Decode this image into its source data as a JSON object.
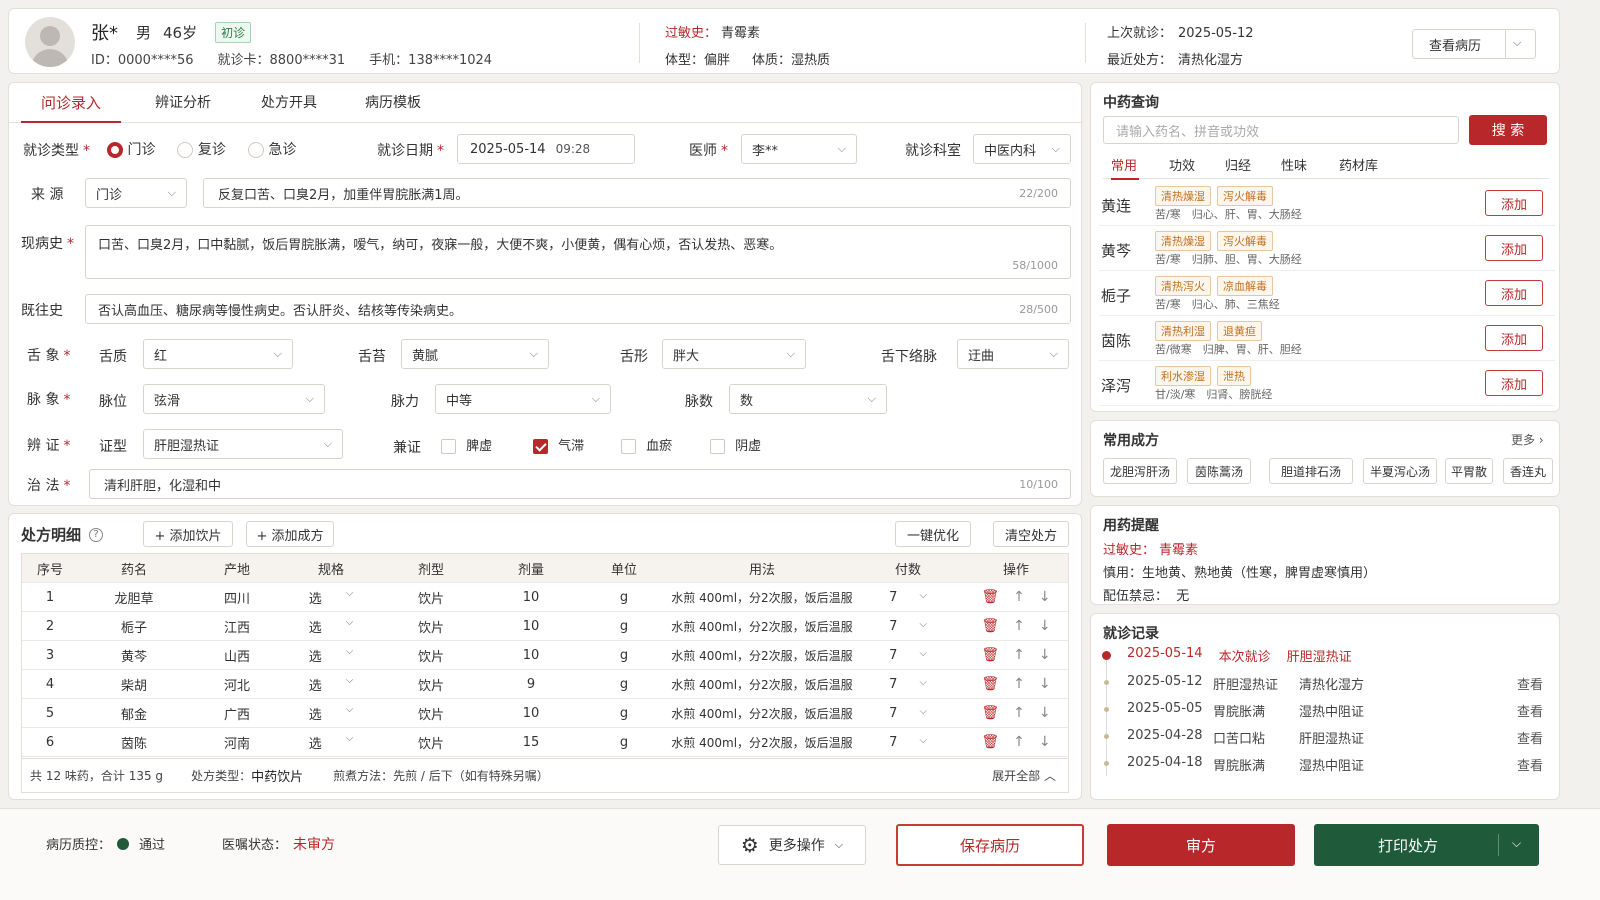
{
  "patient": {
    "name": "张*",
    "gender": "男",
    "age": "46岁",
    "visit_badge": "初诊",
    "id_label": "ID：",
    "id": "0000****56",
    "card_label": "就诊卡：",
    "card": "8800****31",
    "phone_label": "手机：",
    "phone": "138****1024",
    "allergy_label": "过敏史：",
    "allergy": "青霉素",
    "body_type_label": "体型：",
    "body_type": "偏胖",
    "constitution_label": "体质：",
    "constitution": "湿热质",
    "last_visit_label": "上次就诊：",
    "last_visit": "2025-05-12",
    "last_rx_label": "最近处方：",
    "last_rx": "清热化湿方",
    "view_record": "查看病历"
  },
  "tabs": [
    "问诊录入",
    "辨证分析",
    "处方开具",
    "病历模板"
  ],
  "form": {
    "visit_type_label": "就诊类型",
    "visit_types": [
      "门诊",
      "复诊",
      "急诊"
    ],
    "visit_date_label": "就诊日期",
    "visit_date": "2025-05-14",
    "visit_time": "09:28",
    "doctor_label": "医师",
    "doctor": "李**",
    "dept_label": "就诊科室",
    "dept": "中医内科",
    "source_label": "来 源",
    "source": "门诊",
    "chief_complaint": "反复口苦、口臭2月，加重伴胃脘胀满1周。",
    "chief_count": "22/200",
    "present_label": "现病史",
    "present": "口苦、口臭2月，口中黏腻，饭后胃脘胀满，嗳气，纳可，夜寐一般，大便不爽，小便黄，偶有心烦，否认发热、恶寒。",
    "present_count": "58/1000",
    "past_label": "既往史",
    "past": "否认高血压、糖尿病等慢性病史。否认肝炎、结核等传染病史。",
    "past_count": "28/500",
    "tongue_label": "舌 象",
    "tongue_quality_label": "舌质",
    "tongue_quality": "红",
    "tongue_coat_label": "舌苔",
    "tongue_coat": "黄腻",
    "tongue_shape_label": "舌形",
    "tongue_shape": "胖大",
    "sublingual_label": "舌下络脉",
    "sublingual": "迂曲",
    "pulse_label": "脉 象",
    "pulse_pos_label": "脉位",
    "pulse_pos": "弦滑",
    "pulse_force_label": "脉力",
    "pulse_force": "中等",
    "pulse_rate_label": "脉数",
    "pulse_rate": "数",
    "syndrome_label": "辨 证",
    "syndrome_type_label": "证型",
    "syndrome_type": "肝胆湿热证",
    "concurrent_label": "兼证",
    "concurrent": [
      "脾虚",
      "气滞",
      "血瘀",
      "阴虚"
    ],
    "treatment_label": "治 法",
    "treatment": "清利肝胆，化湿和中",
    "treatment_count": "10/100"
  },
  "rx": {
    "title": "处方明细",
    "add_piece": "+ 添加饮片",
    "add_formula": "+ 添加成方",
    "optimize": "一键优化",
    "clear": "清空处方",
    "headers": [
      "序号",
      "药名",
      "产地",
      "规格",
      "剂型",
      "剂量",
      "单位",
      "用法",
      "付数",
      "操作"
    ],
    "rows": [
      {
        "no": "1",
        "name": "龙胆草",
        "origin": "四川",
        "spec": "选",
        "form": "饮片",
        "dose": "10",
        "unit": "g",
        "usage": "水煎 400ml，分2次服，饭后温服",
        "count": "7"
      },
      {
        "no": "2",
        "name": "栀子",
        "origin": "江西",
        "spec": "选",
        "form": "饮片",
        "dose": "10",
        "unit": "g",
        "usage": "水煎 400ml，分2次服，饭后温服",
        "count": "7"
      },
      {
        "no": "3",
        "name": "黄芩",
        "origin": "山西",
        "spec": "选",
        "form": "饮片",
        "dose": "10",
        "unit": "g",
        "usage": "水煎 400ml，分2次服，饭后温服",
        "count": "7"
      },
      {
        "no": "4",
        "name": "柴胡",
        "origin": "河北",
        "spec": "选",
        "form": "饮片",
        "dose": "9",
        "unit": "g",
        "usage": "水煎 400ml，分2次服，饭后温服",
        "count": "7"
      },
      {
        "no": "5",
        "name": "郁金",
        "origin": "广西",
        "spec": "选",
        "form": "饮片",
        "dose": "10",
        "unit": "g",
        "usage": "水煎 400ml，分2次服，饭后温服",
        "count": "7"
      },
      {
        "no": "6",
        "name": "茵陈",
        "origin": "河南",
        "spec": "选",
        "form": "饮片",
        "dose": "15",
        "unit": "g",
        "usage": "水煎 400ml，分2次服，饭后温服",
        "count": "7"
      }
    ],
    "summary": "共 12 味药，合计 135 g",
    "type_label": "处方类型：",
    "type": "中药饮片",
    "decoct": "煎煮方法：先煎 / 后下（如有特殊另嘱）",
    "expand": "展开全部"
  },
  "herb_search": {
    "title": "中药查询",
    "placeholder": "请输入药名、拼音或功效",
    "search": "搜 索",
    "tabs": [
      "常用",
      "功效",
      "归经",
      "性味",
      "药材库"
    ],
    "add": "添加",
    "items": [
      {
        "name": "黄连",
        "tags": [
          "清热燥湿",
          "泻火解毒"
        ],
        "desc": "苦/寒　归心、肝、胃、大肠经"
      },
      {
        "name": "黄芩",
        "tags": [
          "清热燥湿",
          "泻火解毒"
        ],
        "desc": "苦/寒　归肺、胆、胃、大肠经"
      },
      {
        "name": "栀子",
        "tags": [
          "清热泻火",
          "凉血解毒"
        ],
        "desc": "苦/寒　归心、肺、三焦经"
      },
      {
        "name": "茵陈",
        "tags": [
          "清热利湿",
          "退黄疸"
        ],
        "desc": "苦/微寒　归脾、胃、肝、胆经"
      },
      {
        "name": "泽泻",
        "tags": [
          "利水渗湿",
          "泄热"
        ],
        "desc": "甘/淡/寒　归肾、膀胱经"
      }
    ]
  },
  "formulas": {
    "title": "常用成方",
    "more": "更多",
    "items": [
      "龙胆泻肝汤",
      "茵陈蒿汤",
      "胆道排石汤",
      "半夏泻心汤",
      "平胃散",
      "香连丸"
    ]
  },
  "reminder": {
    "title": "用药提醒",
    "allergy_label": "过敏史：",
    "allergy": "青霉素",
    "caution": "慎用：生地黄、熟地黄（性寒，脾胃虚寒慎用）",
    "contra": "配伍禁忌：  无"
  },
  "history": {
    "title": "就诊记录",
    "view": "查看",
    "current": {
      "date": "2025-05-14",
      "label": "本次就诊",
      "syndrome": "肝胆湿热证"
    },
    "items": [
      {
        "date": "2025-05-12",
        "a": "肝胆湿热证",
        "b": "清热化湿方"
      },
      {
        "date": "2025-05-05",
        "a": "胃脘胀满",
        "b": "湿热中阻证"
      },
      {
        "date": "2025-04-28",
        "a": "口苦口粘",
        "b": "肝胆湿热证"
      },
      {
        "date": "2025-04-18",
        "a": "胃脘胀满",
        "b": "湿热中阻证"
      }
    ]
  },
  "footer": {
    "qc_label": "病历质控：",
    "qc": "通过",
    "order_label": "医嘱状态：",
    "order": "未审方",
    "more": "更多操作",
    "save": "保存病历",
    "review": "审方",
    "print": "打印处方"
  },
  "colors": {
    "primary": "#b8282a",
    "green": "#1f5a3a",
    "orange": "#c0711f"
  }
}
